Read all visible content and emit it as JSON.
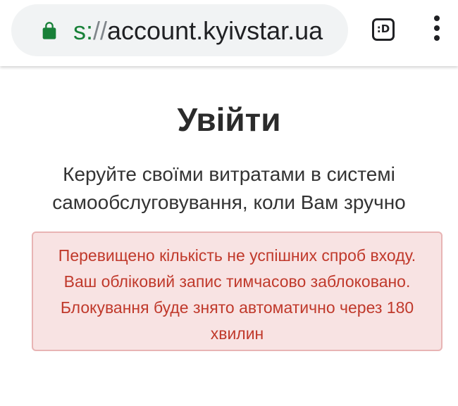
{
  "browser": {
    "url_scheme": "s:",
    "url_sep": "//",
    "url_host": "account.kyivstar.ua",
    "tab_switch_label": ":D",
    "lock_icon": "lock-icon",
    "menu_icon": "more-vert-icon",
    "accent_color": "#188038"
  },
  "login": {
    "title": "Увійти",
    "subtitle": "Керуйте своїми витратами в системі самообслуговування, коли Вам зручно",
    "error_message": "Перевищено кількість не успішних спроб входу. Ваш обліковий запис тимчасово заблоковано. Блокування буде знято автоматично через 180 хвилин",
    "error_color": "#c0392b",
    "error_bg": "#f8e3e3"
  }
}
